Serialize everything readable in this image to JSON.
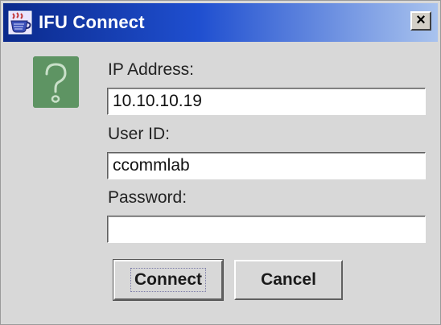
{
  "window": {
    "title": "IFU Connect",
    "close_symbol": "×",
    "app_icon": "java-cup-icon",
    "titlebar_colors": [
      "#0b2a8c",
      "#1f4fd0",
      "#a9c3ee"
    ]
  },
  "dialog": {
    "icon": "question-icon",
    "icon_color": "#5e9463",
    "ip_address": {
      "label": "IP Address:",
      "value": "10.10.10.19"
    },
    "user_id": {
      "label": "User ID:",
      "value": "ccommlab"
    },
    "password": {
      "label": "Password:",
      "value": ""
    }
  },
  "buttons": {
    "connect_label": "Connect",
    "cancel_label": "Cancel"
  }
}
